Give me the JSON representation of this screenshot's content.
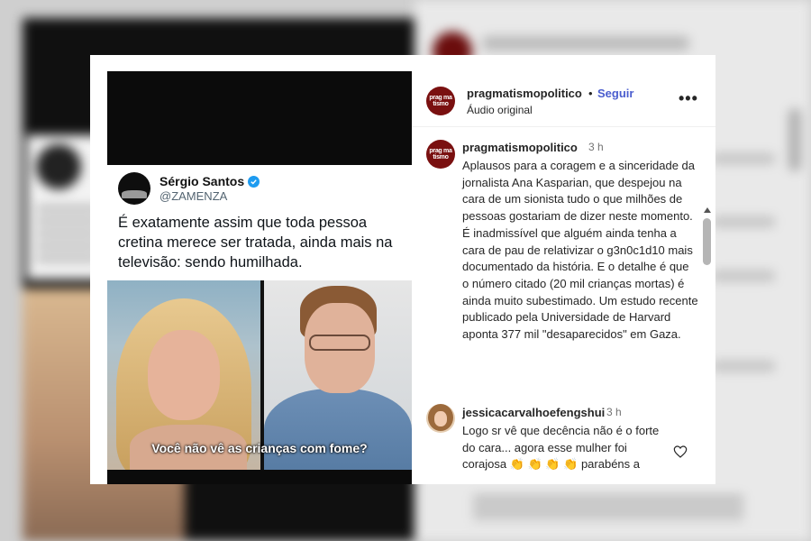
{
  "post_header": {
    "username": "pragmatismopolitico",
    "separator": "•",
    "follow_label": "Seguir",
    "audio_label": "Áudio original",
    "logo_text": "prag ma tismo",
    "more_icon": "more-options-icon"
  },
  "video": {
    "tweet": {
      "name": "Sérgio Santos",
      "handle": "@ZAMENZA",
      "text": "É exatamente assim que toda pessoa cretina merece ser tratada, ainda mais na televisão: sendo humilhada."
    },
    "caption": "Você não vê as crianças com fome?"
  },
  "comments": [
    {
      "username": "pragmatismopolitico",
      "time": "3 h",
      "text": "Aplausos para a coragem e a sinceridade da jornalista Ana Kasparian, que despejou na cara de um sionista tudo o que milhões de pessoas gostariam de dizer neste momento. É inadmissível que alguém ainda tenha a cara de pau de relativizar o g3n0c1d10 mais documentado da história. E o detalhe é que o número citado (20 mil crianças mortas) é ainda muito subestimado. Um estudo recente publicado pela Universidade de Harvard aponta 377 mil \"desaparecidos\" em Gaza."
    },
    {
      "username": "jessicacarvalhoefengshui",
      "time": "3 h",
      "text": "Logo sr vê que decência não é o forte do cara... agora esse mulher foi corajosa 👏 👏 👏 👏 parabéns a"
    }
  ],
  "colors": {
    "follow": "#4a5dce",
    "logo_bg": "#7a1010",
    "verified": "#1d9bf0"
  }
}
